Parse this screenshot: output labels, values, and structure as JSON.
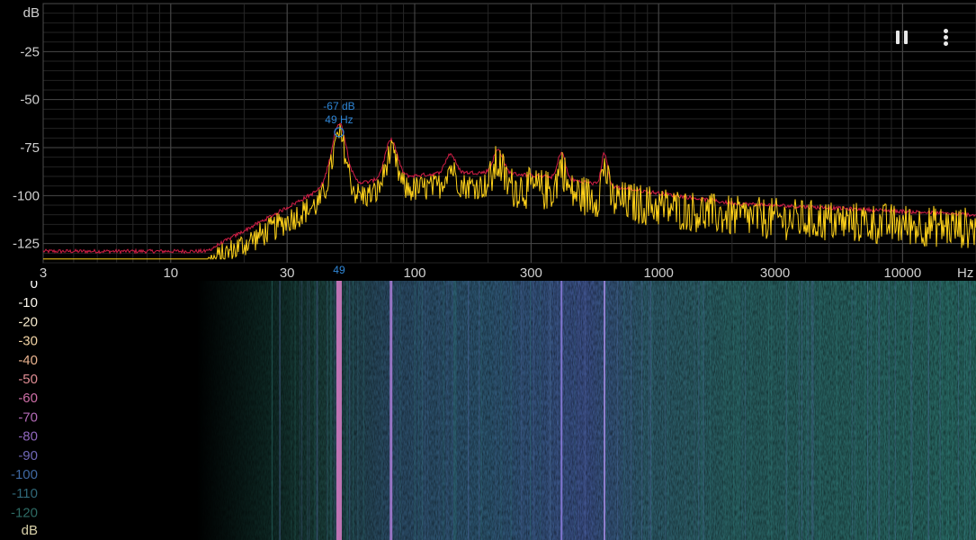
{
  "spectrum": {
    "y_unit": "dB",
    "y_ticks": [
      "-25",
      "-50",
      "-75",
      "-100",
      "-125"
    ],
    "y_tick_values": [
      -25,
      -50,
      -75,
      -100,
      -125
    ],
    "y_range": [
      -135,
      0
    ],
    "x_unit": "Hz",
    "x_ticks": [
      "3",
      "10",
      "30",
      "100",
      "300",
      "1000",
      "3000",
      "10000"
    ],
    "x_tick_values": [
      3,
      10,
      30,
      100,
      300,
      1000,
      3000,
      10000
    ],
    "x_range_hz": [
      3,
      20000
    ],
    "x_scale": "log",
    "peak": {
      "db_label": "-67 dB",
      "hz_label": "49 Hz",
      "axis_label": "49",
      "db": -67,
      "hz": 49
    },
    "colors": {
      "live": "#ffd21a",
      "peak_hold": "#d21e46",
      "marker": "#2f86d6",
      "grid": "#3a3a3a",
      "axis_text": "#cfcfcf"
    }
  },
  "spectrogram": {
    "scale_labels": [
      "0",
      "-10",
      "-20",
      "-30",
      "-40",
      "-50",
      "-60",
      "-70",
      "-80",
      "-90",
      "-100",
      "-110",
      "-120"
    ],
    "scale_colors": [
      "#ffffff",
      "#fbf7ee",
      "#f5e9cc",
      "#f1d3a4",
      "#eab38e",
      "#e08d94",
      "#cf6fa8",
      "#b36ab6",
      "#9067bd",
      "#7068b8",
      "#3f68a2",
      "#306879",
      "#2d6a64"
    ],
    "unit_label": "dB",
    "strong_lines_hz": [
      49,
      80,
      400,
      600
    ]
  },
  "toolbar": {
    "pause_icon": "pause-icon",
    "menu_icon": "more-vert-icon"
  }
}
